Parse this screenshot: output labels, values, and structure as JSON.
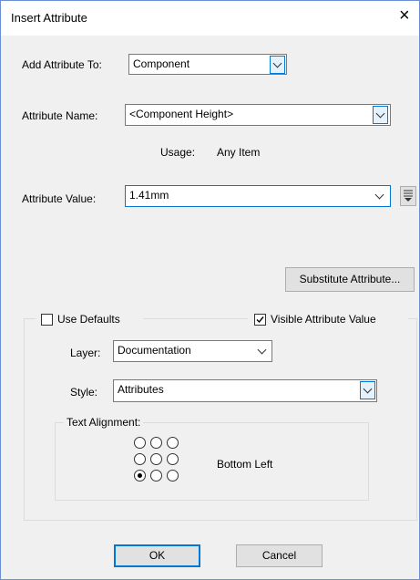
{
  "window": {
    "title": "Insert Attribute",
    "close_glyph": "×"
  },
  "add_to": {
    "label": "Add Attribute To:",
    "value": "Component"
  },
  "attr_name": {
    "label": "Attribute Name:",
    "value": "<Component Height>"
  },
  "usage": {
    "label": "Usage:",
    "value": "Any Item"
  },
  "attr_value": {
    "label": "Attribute Value:",
    "value": "1.41mm"
  },
  "substitute_button": "Substitute Attribute...",
  "use_defaults": {
    "label": "Use Defaults",
    "checked": false
  },
  "visible_value": {
    "label": "Visible Attribute Value",
    "checked": true
  },
  "layer": {
    "label": "Layer:",
    "value": "Documentation"
  },
  "style": {
    "label": "Style:",
    "value": "Attributes"
  },
  "text_alignment": {
    "legend": "Text Alignment:",
    "selected": "Bottom  Left",
    "grid": [
      [
        false,
        false,
        false
      ],
      [
        false,
        false,
        false
      ],
      [
        true,
        false,
        false
      ]
    ]
  },
  "ok_button": "OK",
  "cancel_button": "Cancel",
  "colors": {
    "accent": "#0078d7",
    "dialog_bg": "#f0f0f0"
  }
}
